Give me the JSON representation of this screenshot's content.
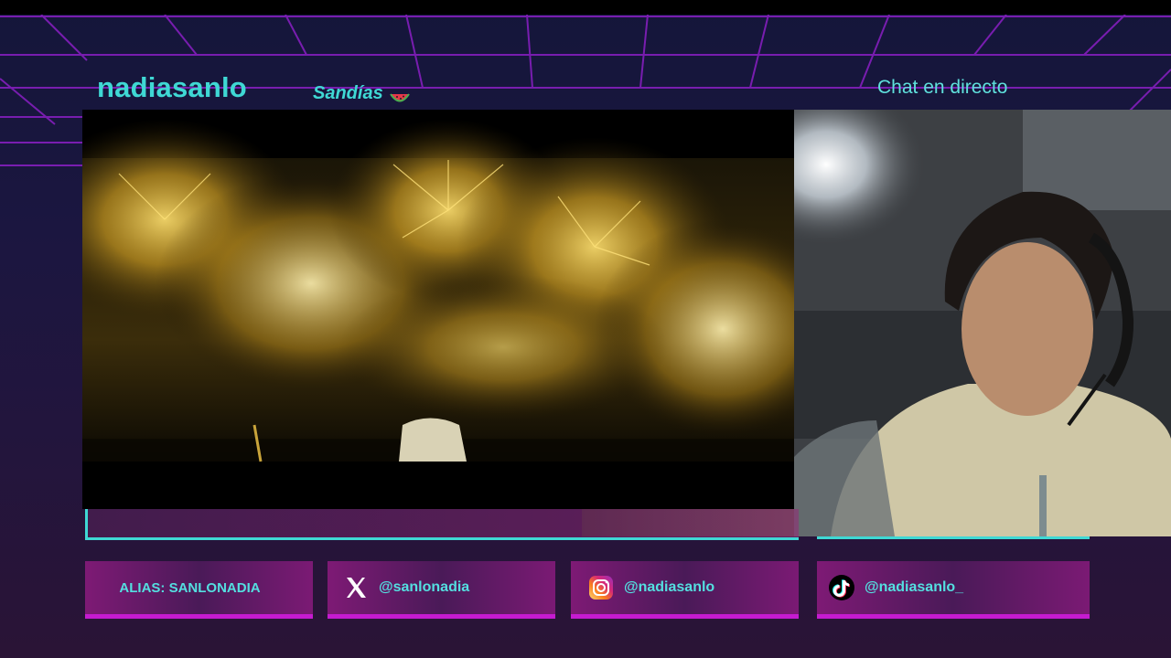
{
  "header": {
    "channel_name": "nadiasanlo",
    "tagline": "Sandías",
    "chat_title": "Chat en directo"
  },
  "social": {
    "alias": "ALIAS: SANLONADIA",
    "x_handle": "@sanlonadia",
    "instagram_handle": "@nadiasanlo",
    "tiktok_handle": "@nadiasanlo_"
  },
  "icons": {
    "tagline": "watermelon-icon",
    "x": "x-logo-icon",
    "instagram": "instagram-icon",
    "tiktok": "tiktok-icon"
  },
  "colors": {
    "accent_cyan": "#3fd8d4",
    "accent_magenta": "#c51bd0",
    "grid_lines": "#8a1fc4",
    "background": "#1b1640"
  }
}
